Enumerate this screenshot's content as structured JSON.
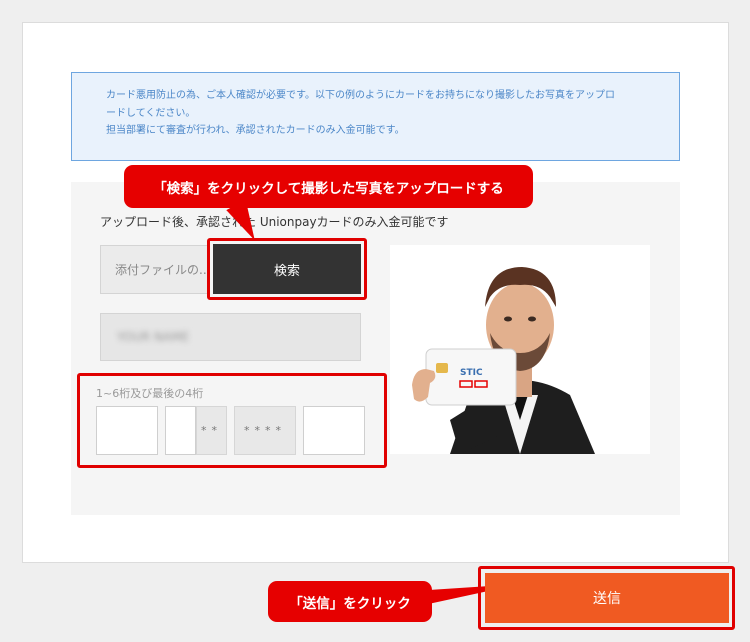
{
  "notice": {
    "line1": "カード悪用防止の為、ご本人確認が必要です。以下の例のようにカードをお持ちになり撮影したお写真をアップロ",
    "line2": "ードしてください。",
    "line3": "担当部署にて審査が行われ、承認されたカードのみ入金可能です。"
  },
  "upload": {
    "note": "アップロード後、承認された Unionpayカードのみ入金可能です",
    "file_placeholder": "添付ファイルの...",
    "search_label": "検索",
    "name_placeholder": "YOUR NAME"
  },
  "digits": {
    "label": "1~6桁及び最後の4桁",
    "mask_short": "**",
    "mask_long": "****"
  },
  "illustration": {
    "card_brand": "STIC"
  },
  "callouts": {
    "top": "「検索」をクリックして撮影した写真をアップロードする",
    "bottom": "「送信」をクリック"
  },
  "submit": {
    "label": "送信"
  },
  "colors": {
    "accent_red": "#e60000",
    "submit_orange": "#f05a22",
    "notice_blue": "#4c87c8"
  }
}
